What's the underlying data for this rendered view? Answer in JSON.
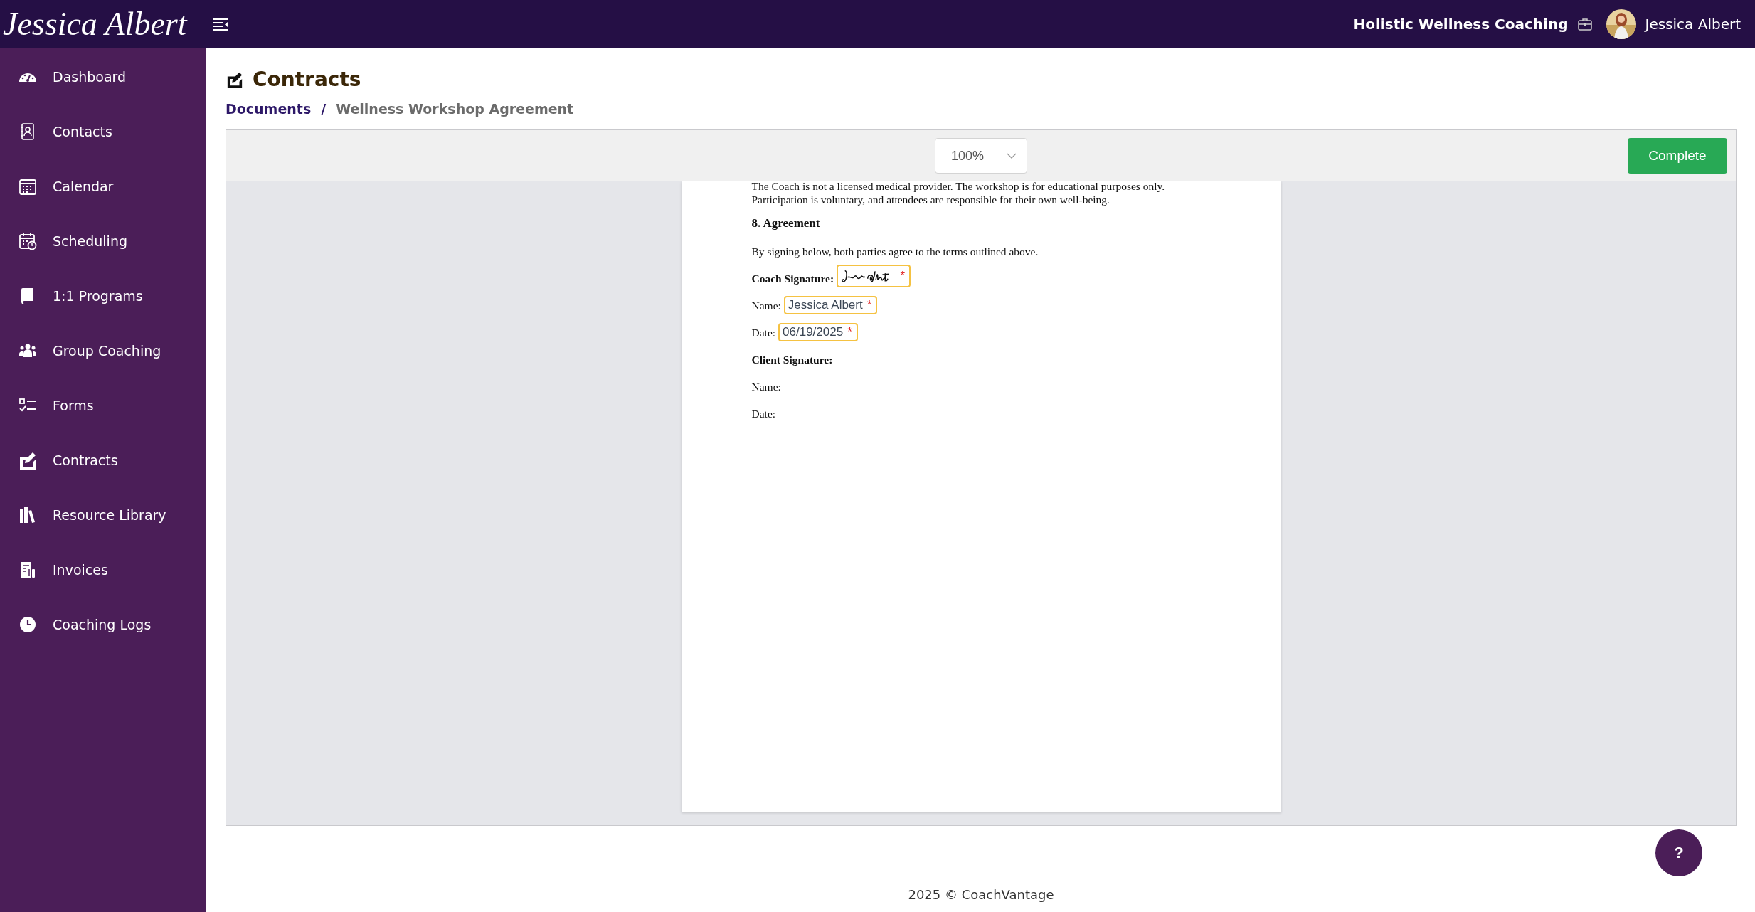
{
  "header": {
    "logo": "Jessica Albert",
    "business": "Holistic Wellness Coaching",
    "user": "Jessica Albert"
  },
  "sidebar": {
    "items": [
      {
        "label": "Dashboard"
      },
      {
        "label": "Contacts"
      },
      {
        "label": "Calendar"
      },
      {
        "label": "Scheduling"
      },
      {
        "label": "1:1 Programs"
      },
      {
        "label": "Group Coaching"
      },
      {
        "label": "Forms"
      },
      {
        "label": "Contracts"
      },
      {
        "label": "Resource Library"
      },
      {
        "label": "Invoices"
      },
      {
        "label": "Coaching Logs"
      }
    ]
  },
  "page": {
    "title": "Contracts",
    "breadcrumb": [
      {
        "label": "Documents",
        "kind": "link"
      },
      {
        "label": "/",
        "kind": "separator"
      },
      {
        "label": "Wellness Workshop Agreement",
        "kind": "current"
      }
    ]
  },
  "viewer": {
    "zoom": "100%",
    "complete_button": "Complete",
    "document": [
      {
        "kind": "paragraph",
        "text": "The Coach is not a licensed medical provider. The workshop is for educational purposes only. Participation is voluntary, and attendees are responsible for their own well-being."
      },
      {
        "kind": "heading",
        "text": "8. Agreement"
      },
      {
        "kind": "paragraph",
        "text": "By signing below, both parties agree to the terms outlined above."
      },
      {
        "kind": "signature",
        "label": "Coach Signature:",
        "signed": true,
        "marker": "*"
      },
      {
        "kind": "field",
        "label": "Name:",
        "value": "Jessica Albert",
        "marker": "*"
      },
      {
        "kind": "field",
        "label": "Date:",
        "value": "06/19/2025",
        "marker": "*"
      },
      {
        "kind": "signature",
        "label": "Client Signature:",
        "signed": false
      },
      {
        "kind": "field",
        "label": "Name:"
      },
      {
        "kind": "field",
        "label": "Date:"
      }
    ]
  },
  "footer": {
    "text": "2025 © CoachVantage"
  },
  "help_button": "?"
}
